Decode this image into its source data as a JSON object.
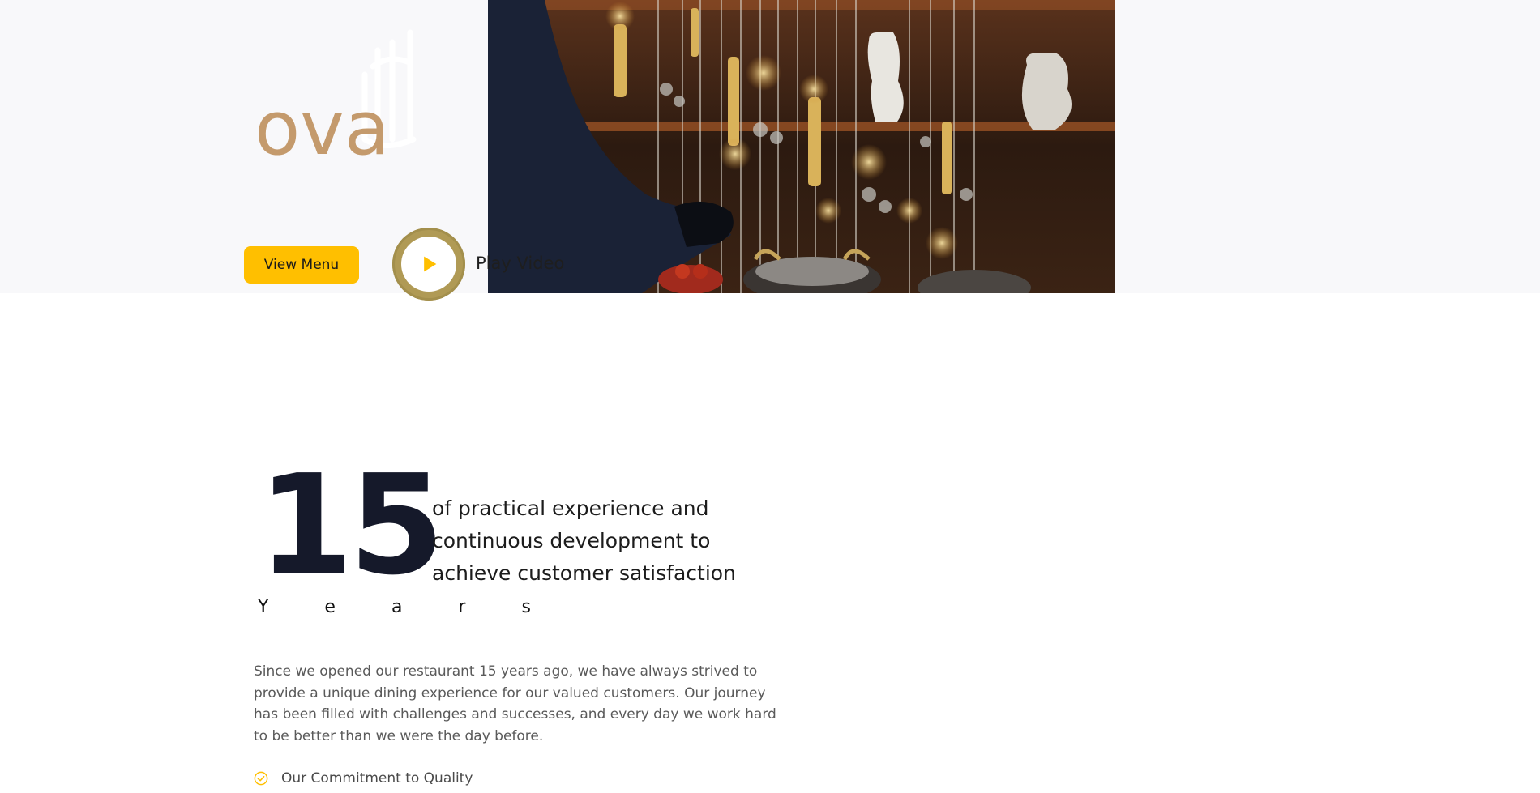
{
  "hero": {
    "logo_latin": "ova",
    "view_menu_label": "View Menu",
    "play_video_label": "Play Video"
  },
  "stats": {
    "number": "15",
    "unit": "Y e a r s",
    "tagline": "of practical experience and continuous development to achieve customer satisfaction"
  },
  "about": {
    "paragraph": "Since we opened our restaurant 15 years ago, we have always strived to provide a unique dining experience for our valued customers. Our journey has been filled with challenges and successes, and every day we work hard to be better than we were the day before.",
    "features": [
      {
        "label": "Our Commitment to Quality"
      }
    ]
  },
  "colors": {
    "accent": "#ffbf00",
    "brand_gold": "#c49a6c",
    "play_ring": "#b09a55",
    "heading": "#15192a"
  },
  "icons": {
    "play": "play-icon",
    "check": "check-circle-icon"
  }
}
